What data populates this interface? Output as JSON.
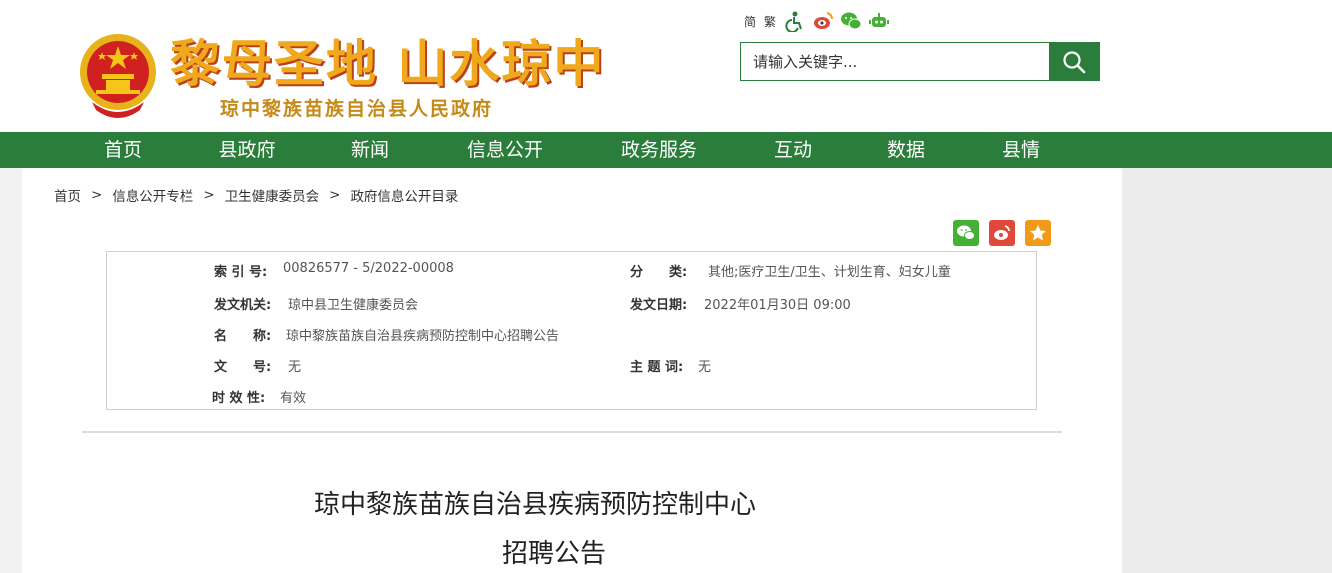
{
  "header": {
    "slogan": "黎母圣地 山水琼中",
    "gov_name": "琼中黎族苗族自治县人民政府",
    "tools": {
      "simplified": "简",
      "traditional": "繁"
    },
    "search": {
      "placeholder": "请输入关键字..."
    }
  },
  "nav": {
    "items": [
      {
        "label": "首页"
      },
      {
        "label": "县政府"
      },
      {
        "label": "新闻"
      },
      {
        "label": "信息公开"
      },
      {
        "label": "政务服务"
      },
      {
        "label": "互动"
      },
      {
        "label": "数据"
      },
      {
        "label": "县情"
      }
    ]
  },
  "breadcrumb": {
    "items": [
      "首页",
      "信息公开专栏",
      "卫生健康委员会",
      "政府信息公开目录"
    ],
    "separator": ">"
  },
  "meta": {
    "index_label": "索 引 号:",
    "index_value": "00826577 - 5/2022-00008",
    "category_label": "分　　类:",
    "category_value": "其他;医疗卫生/卫生、计划生育、妇女儿童",
    "issuer_label": "发文机关:",
    "issuer_value": "琼中县卫生健康委员会",
    "date_label": "发文日期:",
    "date_value": "2022年01月30日 09:00",
    "name_label": "名　　称:",
    "name_value": "琼中黎族苗族自治县疾病预防控制中心招聘公告",
    "docno_label": "文　　号:",
    "docno_value": "无",
    "topic_label": "主 题 词:",
    "topic_value": "无",
    "validity_label": "时 效 性:",
    "validity_value": "有效"
  },
  "article": {
    "title_line1": "琼中黎族苗族自治县疾病预防控制中心",
    "title_line2": "招聘公告"
  },
  "colors": {
    "brand_green": "#2a7d3a",
    "slogan_gold": "#f0a81c",
    "wechat_green": "#45b035",
    "weibo_red": "#e0483a",
    "favorite_orange": "#f19a1a"
  }
}
